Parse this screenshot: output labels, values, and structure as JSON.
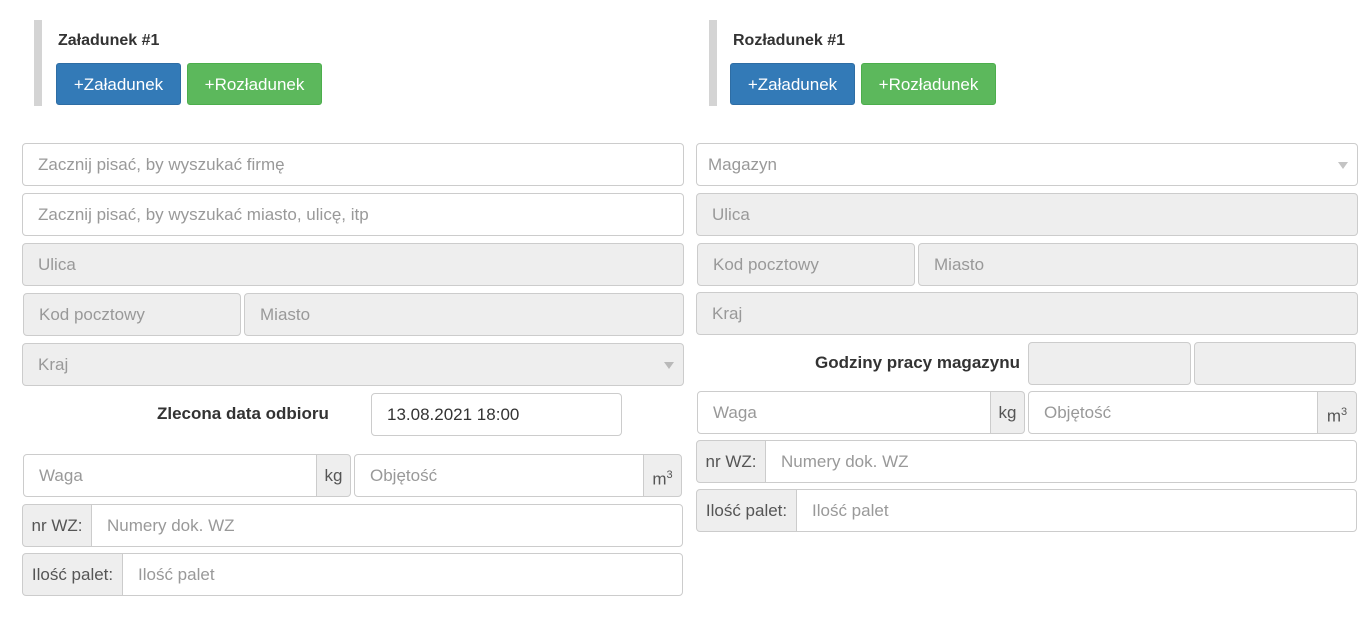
{
  "loading": {
    "title": "Załadunek #1",
    "add_loading_label": "+Załadunek",
    "add_unloading_label": "+Rozładunek",
    "company_search_placeholder": "Zacznij pisać, by wyszukać firmę",
    "address_search_placeholder": "Zacznij pisać, by wyszukać miasto, ulicę, itp",
    "street_placeholder": "Ulica",
    "postal_code_placeholder": "Kod pocztowy",
    "city_placeholder": "Miasto",
    "country_placeholder": "Kraj",
    "pickup_date_label": "Zlecona data odbioru",
    "pickup_date_value": "13.08.2021 18:00",
    "weight_placeholder": "Waga",
    "weight_unit": "kg",
    "volume_placeholder": "Objętość",
    "volume_unit": "m",
    "volume_unit_exp": "3",
    "wz_label": "nr WZ:",
    "wz_placeholder": "Numery dok. WZ",
    "pallets_label": "Ilość palet:",
    "pallets_placeholder": "Ilość palet"
  },
  "unloading": {
    "title": "Rozładunek #1",
    "add_loading_label": "+Załadunek",
    "add_unloading_label": "+Rozładunek",
    "warehouse_placeholder": "Magazyn",
    "street_placeholder": "Ulica",
    "postal_code_placeholder": "Kod pocztowy",
    "city_placeholder": "Miasto",
    "country_placeholder": "Kraj",
    "hours_label": "Godziny pracy magazynu",
    "hours_from": "",
    "hours_to": "",
    "weight_placeholder": "Waga",
    "weight_unit": "kg",
    "volume_placeholder": "Objętość",
    "volume_unit": "m",
    "volume_unit_exp": "3",
    "wz_label": "nr WZ:",
    "wz_placeholder": "Numery dok. WZ",
    "pallets_label": "Ilość palet:",
    "pallets_placeholder": "Ilość palet"
  },
  "colors": {
    "primary_button": "#337ab7",
    "success_button": "#5cb85c",
    "disabled_field": "#eeeeee"
  }
}
